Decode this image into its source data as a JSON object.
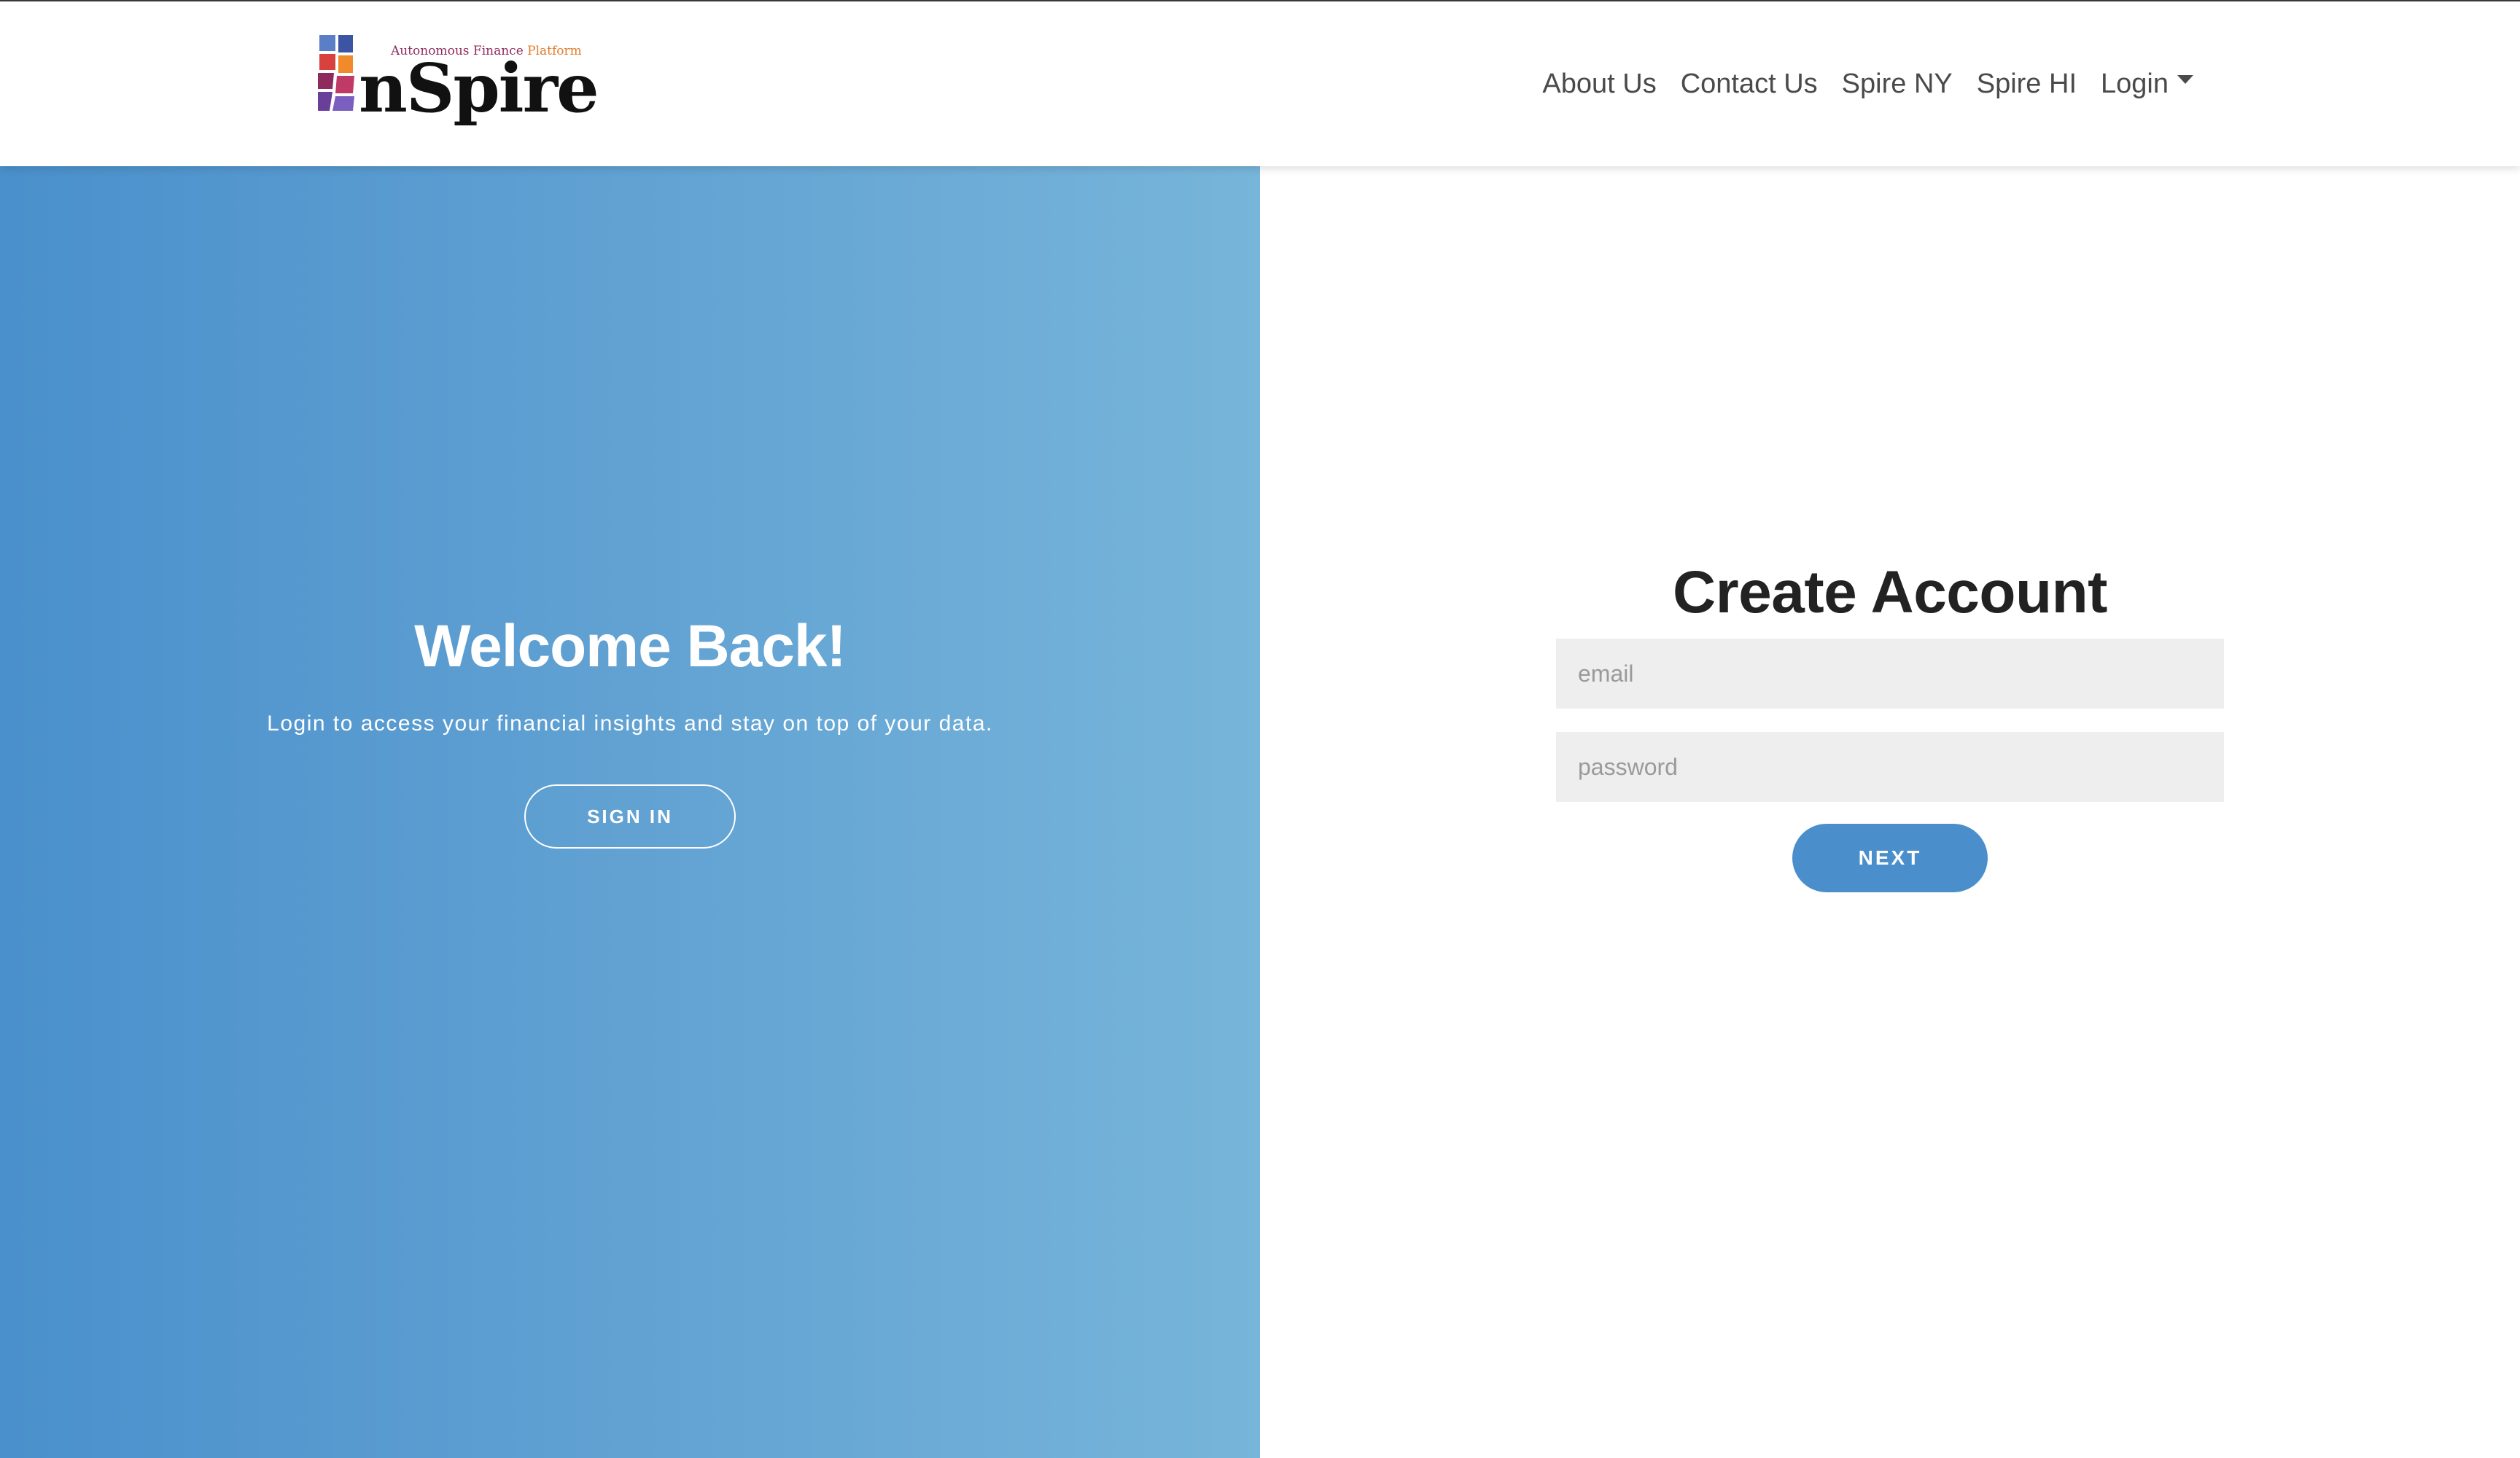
{
  "header": {
    "brand": {
      "tagline_part1": "Autonomous Finance",
      "tagline_part2": "Platform",
      "name": "nSpire",
      "mark_icon": "inspire-logo-mark-icon",
      "tagline_colors": [
        "#8e2a5c",
        "#e07a2a"
      ]
    },
    "nav": {
      "about": "About Us",
      "contact": "Contact Us",
      "spire_ny": "Spire NY",
      "spire_hi": "Spire HI",
      "login": "Login",
      "login_caret_icon": "caret-down-icon"
    }
  },
  "welcome_panel": {
    "title": "Welcome Back!",
    "subtitle": "Login to access your financial insights and stay on top of your data.",
    "sign_in_label": "SIGN IN",
    "gradient_colors": [
      "#4a90cc",
      "#77b5da"
    ]
  },
  "signup_panel": {
    "title": "Create Account",
    "email": {
      "placeholder": "email",
      "value": ""
    },
    "password": {
      "placeholder": "password",
      "value": ""
    },
    "next_label": "NEXT",
    "accent_color": "#4a8fcc"
  }
}
